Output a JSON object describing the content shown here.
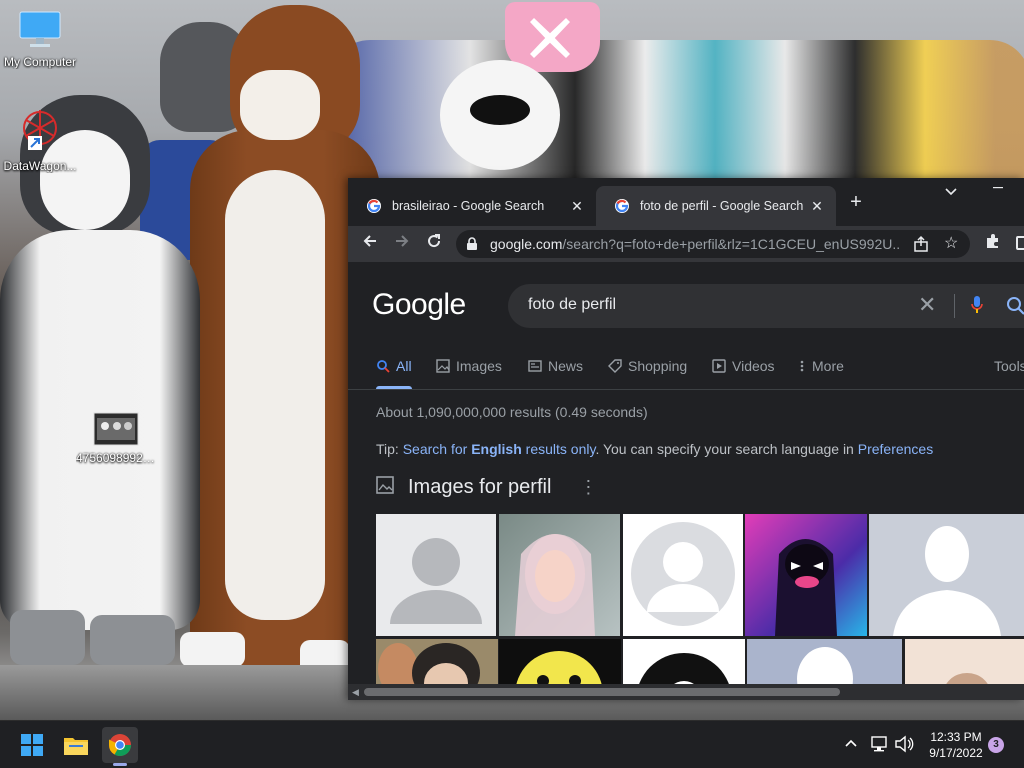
{
  "desktop": {
    "icons": [
      {
        "label": "My Computer",
        "icon": "monitor-icon"
      },
      {
        "label": "DataWagon...",
        "icon": "shortcut-icon"
      },
      {
        "label": "4756098992_...",
        "icon": "image-file-icon"
      }
    ]
  },
  "browser": {
    "tabs": [
      {
        "title": "brasileirao - Google Search",
        "active": false
      },
      {
        "title": "foto de perfil - Google Search",
        "active": true
      }
    ],
    "new_tab_label": "+",
    "url_host": "google.com",
    "url_path": "/search?q=foto+de+perfil&rlz=1C1GCEU_enUS992U..."
  },
  "search": {
    "logo": "Google",
    "query": "foto de perfil",
    "tabs": [
      {
        "label": "All",
        "icon": "search-icon"
      },
      {
        "label": "Images",
        "icon": "image-icon"
      },
      {
        "label": "News",
        "icon": "news-icon"
      },
      {
        "label": "Shopping",
        "icon": "tag-icon"
      },
      {
        "label": "Videos",
        "icon": "play-icon"
      },
      {
        "label": "More",
        "icon": "kebab-icon"
      }
    ],
    "tools_label": "Tools",
    "result_stats": "About 1,090,000,000 results (0.49 seconds)",
    "tip": {
      "prefix": "Tip: ",
      "link_a": "Search for ",
      "link_bold": "English",
      "link_b": " results only",
      "middle": ". You can specify your search language in ",
      "link_prefs": "Preferences"
    },
    "images_title": "Images for perfil"
  },
  "taskbar": {
    "time": "12:33 PM",
    "date": "9/17/2022",
    "notifications": "3"
  },
  "colors": {
    "accent": "#8ab4f8",
    "page_bg": "#202124",
    "toolbar_bg": "#35363a"
  }
}
